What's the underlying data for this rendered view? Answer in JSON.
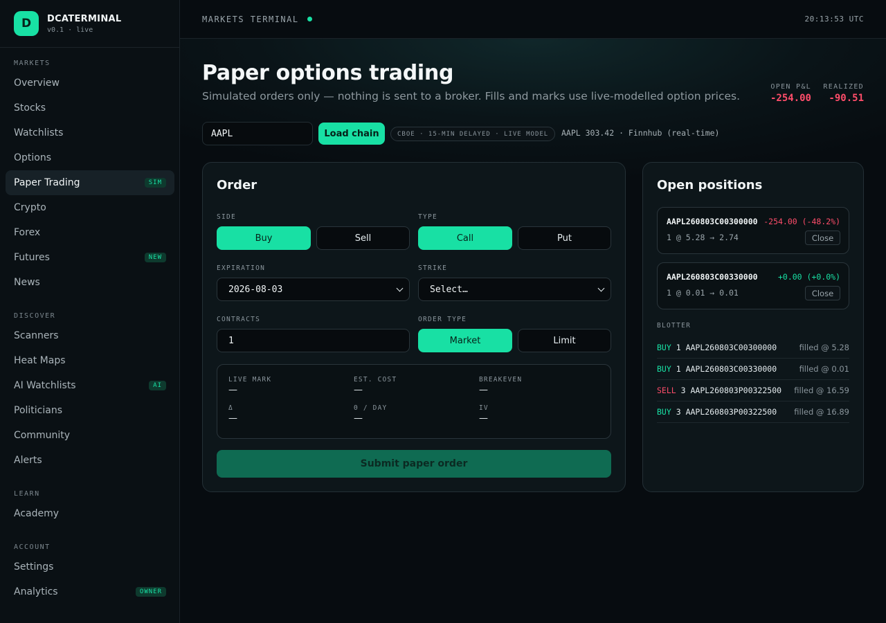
{
  "brand": {
    "logo": "D",
    "name": "DCATERMINAL",
    "version": "v0.1 · live"
  },
  "sidebar": {
    "sections": [
      {
        "label": "MARKETS",
        "items": [
          {
            "label": "Overview"
          },
          {
            "label": "Stocks"
          },
          {
            "label": "Watchlists"
          },
          {
            "label": "Options"
          },
          {
            "label": "Paper Trading",
            "badge": "SIM",
            "active": true
          },
          {
            "label": "Crypto"
          },
          {
            "label": "Forex"
          },
          {
            "label": "Futures",
            "badge": "NEW"
          },
          {
            "label": "News"
          }
        ]
      },
      {
        "label": "DISCOVER",
        "items": [
          {
            "label": "Scanners"
          },
          {
            "label": "Heat Maps"
          },
          {
            "label": "AI Watchlists",
            "badge": "AI"
          },
          {
            "label": "Politicians"
          },
          {
            "label": "Community"
          },
          {
            "label": "Alerts"
          }
        ]
      },
      {
        "label": "LEARN",
        "items": [
          {
            "label": "Academy"
          }
        ]
      },
      {
        "label": "ACCOUNT",
        "items": [
          {
            "label": "Settings"
          },
          {
            "label": "Analytics",
            "badge": "OWNER"
          }
        ]
      }
    ]
  },
  "topbar": {
    "title": "MARKETS TERMINAL",
    "clock": "20:13:53 UTC"
  },
  "page": {
    "title": "Paper options trading",
    "subtitle": "Simulated orders only — nothing is sent to a broker. Fills and marks use live-modelled option prices."
  },
  "pnl": {
    "open_label": "OPEN P&L",
    "open_value": "-254.00",
    "realized_label": "REALIZED",
    "realized_value": "-90.51"
  },
  "chain": {
    "ticker": "AAPL",
    "load_label": "Load chain",
    "feed": "CBOE · 15-MIN DELAYED · LIVE MODEL",
    "quote": "AAPL 303.42 · Finnhub (real-time)"
  },
  "order": {
    "title": "Order",
    "side_label": "SIDE",
    "buy": "Buy",
    "sell": "Sell",
    "type_label": "TYPE",
    "call": "Call",
    "put": "Put",
    "expiration_label": "EXPIRATION",
    "expiration": "2026-08-03",
    "strike_label": "STRIKE",
    "strike": "Select…",
    "contracts_label": "CONTRACTS",
    "contracts": "1",
    "order_type_label": "ORDER TYPE",
    "market": "Market",
    "limit": "Limit",
    "stats": {
      "live_mark_label": "LIVE MARK",
      "live_mark": "—",
      "est_cost_label": "EST. COST",
      "est_cost": "—",
      "breakeven_label": "BREAKEVEN",
      "breakeven": "—",
      "delta_label": "Δ",
      "delta": "—",
      "theta_label": "Θ / DAY",
      "theta": "—",
      "iv_label": "IV",
      "iv": "—"
    },
    "submit": "Submit paper order"
  },
  "positions": {
    "title": "Open positions",
    "items": [
      {
        "symbol": "AAPL260803C00300000",
        "pnl": "-254.00 (-48.2%)",
        "fill": "1 @ 5.28 → 2.74",
        "close": "Close"
      },
      {
        "symbol": "AAPL260803C00330000",
        "pnl": "+0.00 (+0.0%)",
        "fill": "1 @ 0.01 → 0.01",
        "close": "Close"
      }
    ]
  },
  "blotter": {
    "label": "BLOTTER",
    "rows": [
      {
        "side": "BUY",
        "text": "1 AAPL260803C00300000",
        "fill": "filled @ 5.28"
      },
      {
        "side": "BUY",
        "text": "1 AAPL260803C00330000",
        "fill": "filled @ 0.01"
      },
      {
        "side": "SELL",
        "text": "3 AAPL260803P00322500",
        "fill": "filled @ 16.59"
      },
      {
        "side": "BUY",
        "text": "3 AAPL260803P00322500",
        "fill": "filled @ 16.89"
      }
    ]
  },
  "colors": {
    "accent": "#18e0a4",
    "negative": "#ff4d6a",
    "background": "#070c10"
  }
}
